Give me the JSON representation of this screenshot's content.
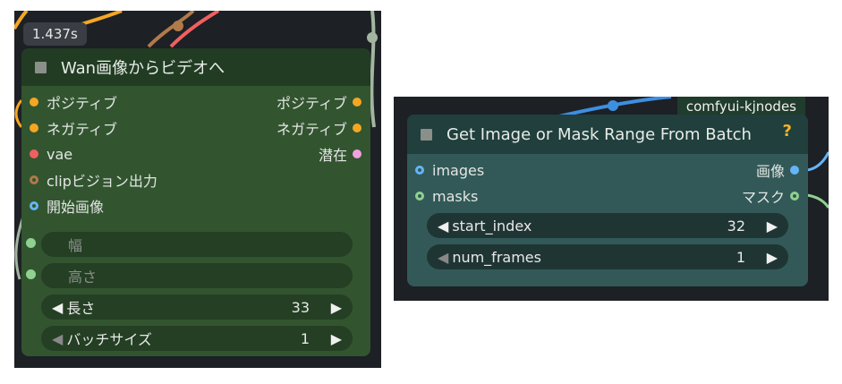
{
  "colors": {
    "canvas": "#1d2025",
    "wan_node_body": "#325530",
    "wan_node_header": "#213c22",
    "kj_node_body": "#325958",
    "kj_node_header": "#203f3d",
    "slot_orange": "#f5a623",
    "slot_red": "#f06060",
    "slot_brown": "#b07a4a",
    "slot_blue": "#64b5f6",
    "slot_green": "#8fd18f",
    "slot_pink": "#f3a0e0"
  },
  "left": {
    "timer_badge": "1.437s",
    "node": {
      "title": "Wan画像からビデオへ",
      "inputs": [
        {
          "label": "ポジティブ",
          "color": "orange"
        },
        {
          "label": "ネガティブ",
          "color": "orange"
        },
        {
          "label": "vae",
          "color": "red"
        },
        {
          "label": "clipビジョン出力",
          "color": "brown"
        },
        {
          "label": "開始画像",
          "color": "blue"
        }
      ],
      "outputs": [
        {
          "label": "ポジティブ",
          "color": "orange"
        },
        {
          "label": "ネガティブ",
          "color": "orange"
        },
        {
          "label": "潜在",
          "color": "pink"
        }
      ],
      "widgets": [
        {
          "label": "幅",
          "value": ""
        },
        {
          "label": "高さ",
          "value": ""
        },
        {
          "label": "長さ",
          "value": "33"
        },
        {
          "label": "バッチサイズ",
          "value": "1"
        }
      ]
    }
  },
  "right": {
    "source_badge": "comfyui-kjnodes",
    "node": {
      "title": "Get Image or Mask Range From Batch",
      "help": "?",
      "inputs": [
        {
          "label": "images",
          "color": "blue"
        },
        {
          "label": "masks",
          "color": "green"
        }
      ],
      "outputs": [
        {
          "label": "画像",
          "color": "blue"
        },
        {
          "label": "マスク",
          "color": "green"
        }
      ],
      "widgets": [
        {
          "label": "start_index",
          "value": "32"
        },
        {
          "label": "num_frames",
          "value": "1"
        }
      ]
    }
  }
}
